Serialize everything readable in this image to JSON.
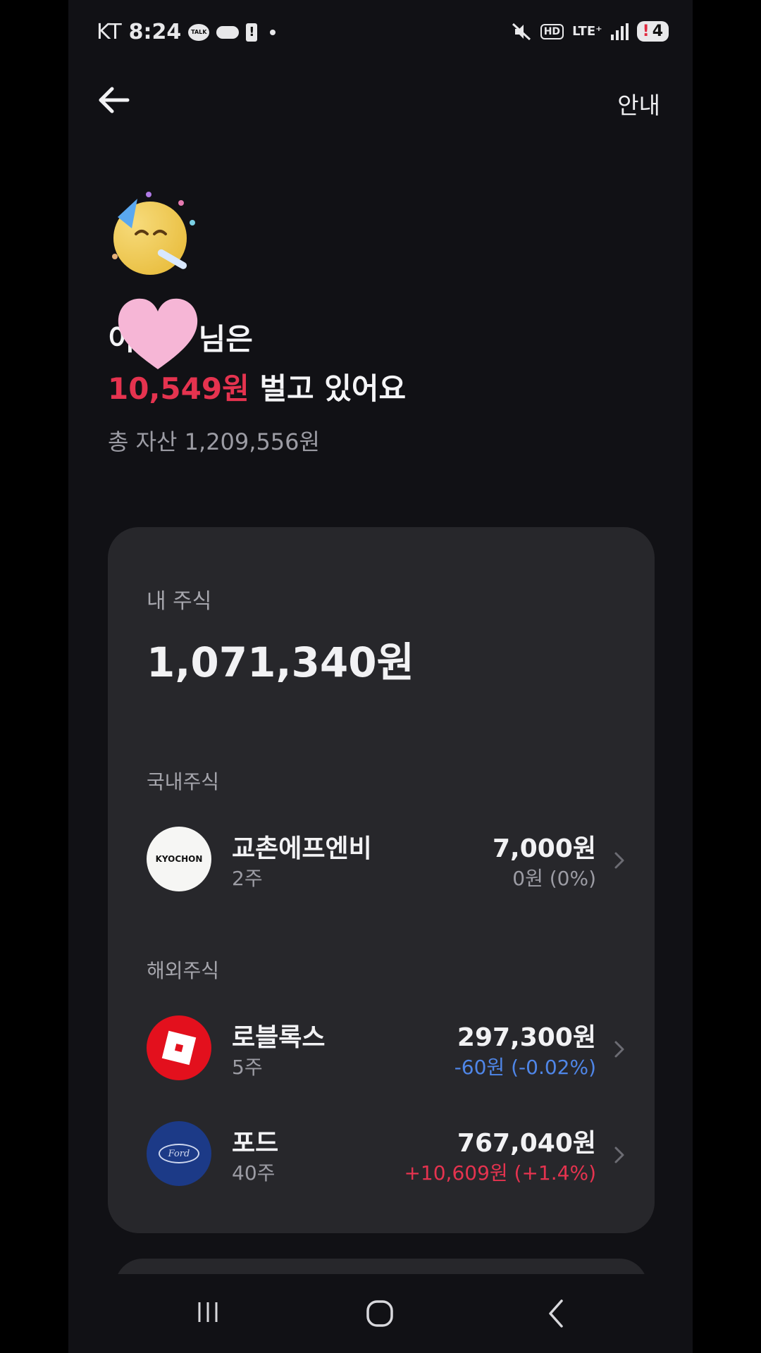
{
  "status_bar": {
    "carrier": "KT",
    "time": "8:24",
    "talk_label": "TALK",
    "lte": "LTE⁺",
    "battery": "4"
  },
  "header": {
    "info_label": "안내"
  },
  "hero": {
    "name_suffix": "님은",
    "name_prefix": "이",
    "earning_amount": "10,549원",
    "earning_suffix": " 벌고 있어요",
    "total_assets": "총 자산 1,209,556원"
  },
  "card": {
    "label": "내 주식",
    "total": "1,071,340원",
    "domestic_label": "국내주식",
    "overseas_label": "해외주식",
    "domestic": [
      {
        "name": "교촌에프엔비",
        "shares": "2주",
        "value": "7,000원",
        "change": "0원 (0%)",
        "logo_text": "KYOCHON"
      }
    ],
    "overseas": [
      {
        "name": "로블록스",
        "shares": "5주",
        "value": "297,300원",
        "change": "-60원 (-0.02%)"
      },
      {
        "name": "포드",
        "shares": "40주",
        "value": "767,040원",
        "change": "+10,609원 (+1.4%)",
        "logo_text": "Ford"
      }
    ]
  },
  "colors": {
    "accent_red": "#e5334f",
    "accent_blue": "#4f86e8",
    "card_bg": "#27272b",
    "page_bg": "#111115"
  }
}
